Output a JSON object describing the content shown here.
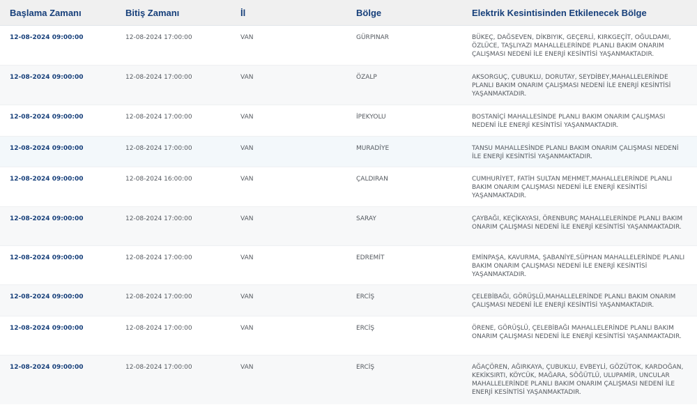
{
  "table": {
    "columns": [
      "Başlama Zamanı",
      "Bitiş Zamanı",
      "İl",
      "Bölge",
      "Elektrik Kesintisinden Etkilenecek Bölge"
    ],
    "rows": [
      {
        "start": "12-08-2024 09:00:00",
        "end": "12-08-2024 17:00:00",
        "province": "VAN",
        "district": "GÜRPINAR",
        "area": "BÜKEÇ, DAĞSEVEN, DİKBIYIK, GEÇERLİ, KIRKGEÇİT, OĞULDAMI, ÖZLÜCE, TAŞLIYAZI MAHALLELERİNDE PLANLI BAKIM ONARIM ÇALIŞMASI NEDENİ İLE ENERJİ KESİNTİSİ YAŞANMAKTADIR."
      },
      {
        "start": "12-08-2024 09:00:00",
        "end": "12-08-2024 17:00:00",
        "province": "VAN",
        "district": "ÖZALP",
        "area": "AKSORGUÇ, ÇUBUKLU, DORUTAY, SEYDİBEY,MAHALLELERİNDE PLANLI BAKIM ONARIM ÇALIŞMASI NEDENİ İLE ENERJİ KESİNTİSİ YAŞANMAKTADIR."
      },
      {
        "start": "12-08-2024 09:00:00",
        "end": "12-08-2024 17:00:00",
        "province": "VAN",
        "district": "İPEKYOLU",
        "area": "BOSTANİÇİ MAHALLESİNDE PLANLI BAKIM ONARIM ÇALIŞMASI NEDENİ İLE ENERJİ KESİNTİSİ YAŞANMAKTADIR."
      },
      {
        "start": "12-08-2024 09:00:00",
        "end": "12-08-2024 17:00:00",
        "province": "VAN",
        "district": "MURADİYE",
        "area": "TANSU MAHALLESİNDE PLANLI BAKIM ONARIM ÇALIŞMASI NEDENİ İLE ENERJİ KESİNTİSİ YAŞANMAKTADIR."
      },
      {
        "start": "12-08-2024 09:00:00",
        "end": "12-08-2024 16:00:00",
        "province": "VAN",
        "district": "ÇALDIRAN",
        "area": "CUMHURİYET, FATİH SULTAN MEHMET,MAHALLELERİNDE PLANLI BAKIM ONARIM ÇALIŞMASI NEDENİ İLE ENERJİ KESİNTİSİ YAŞANMAKTADIR."
      },
      {
        "start": "12-08-2024 09:00:00",
        "end": "12-08-2024 17:00:00",
        "province": "VAN",
        "district": "SARAY",
        "area": "ÇAYBAĞI, KEÇİKAYASI, ÖRENBURÇ MAHALLELERİNDE PLANLI BAKIM ONARIM ÇALIŞMASI NEDENİ İLE ENERJİ KESİNTİSİ YAŞANMAKTADIR."
      },
      {
        "start": "12-08-2024 09:00:00",
        "end": "12-08-2024 17:00:00",
        "province": "VAN",
        "district": "EDREMİT",
        "area": "EMİNPAŞA, KAVURMA, ŞABANİYE,SÜPHAN MAHALLELERİNDE PLANLI BAKIM ONARIM ÇALIŞMASI NEDENİ İLE ENERJİ KESİNTİSİ YAŞANMAKTADIR."
      },
      {
        "start": "12-08-2024 09:00:00",
        "end": "12-08-2024 17:00:00",
        "province": "VAN",
        "district": "ERCİŞ",
        "area": "ÇELEBİBAĞI, GÖRÜŞLÜ,MAHALLELERİNDE PLANLI BAKIM ONARIM ÇALIŞMASI NEDENİ İLE ENERJİ KESİNTİSİ YAŞANMAKTADIR."
      },
      {
        "start": "12-08-2024 09:00:00",
        "end": "12-08-2024 17:00:00",
        "province": "VAN",
        "district": "ERCİŞ",
        "area": "ÖRENE, GÖRÜŞLÜ, ÇELEBİBAĞI MAHALLELERİNDE PLANLI BAKIM ONARIM ÇALIŞMASI NEDENİ İLE ENERJİ KESİNTİSİ YAŞANMAKTADIR."
      },
      {
        "start": "12-08-2024 09:00:00",
        "end": "12-08-2024 17:00:00",
        "province": "VAN",
        "district": "ERCİŞ",
        "area": "AĞAÇÖREN, AĞIRKAYA, ÇUBUKLU, EVBEYLİ, GÖZÜTOK, KARDOĞAN, KEKİKSIRTI, KÖYCÜK, MAĞARA, SÖĞÜTLÜ, ULUPAMİR, UNCULAR MAHALLELERİNDE PLANLI BAKIM ONARIM ÇALIŞMASI NEDENİ İLE ENERJİ KESİNTİSİ YAŞANMAKTADIR."
      }
    ]
  }
}
